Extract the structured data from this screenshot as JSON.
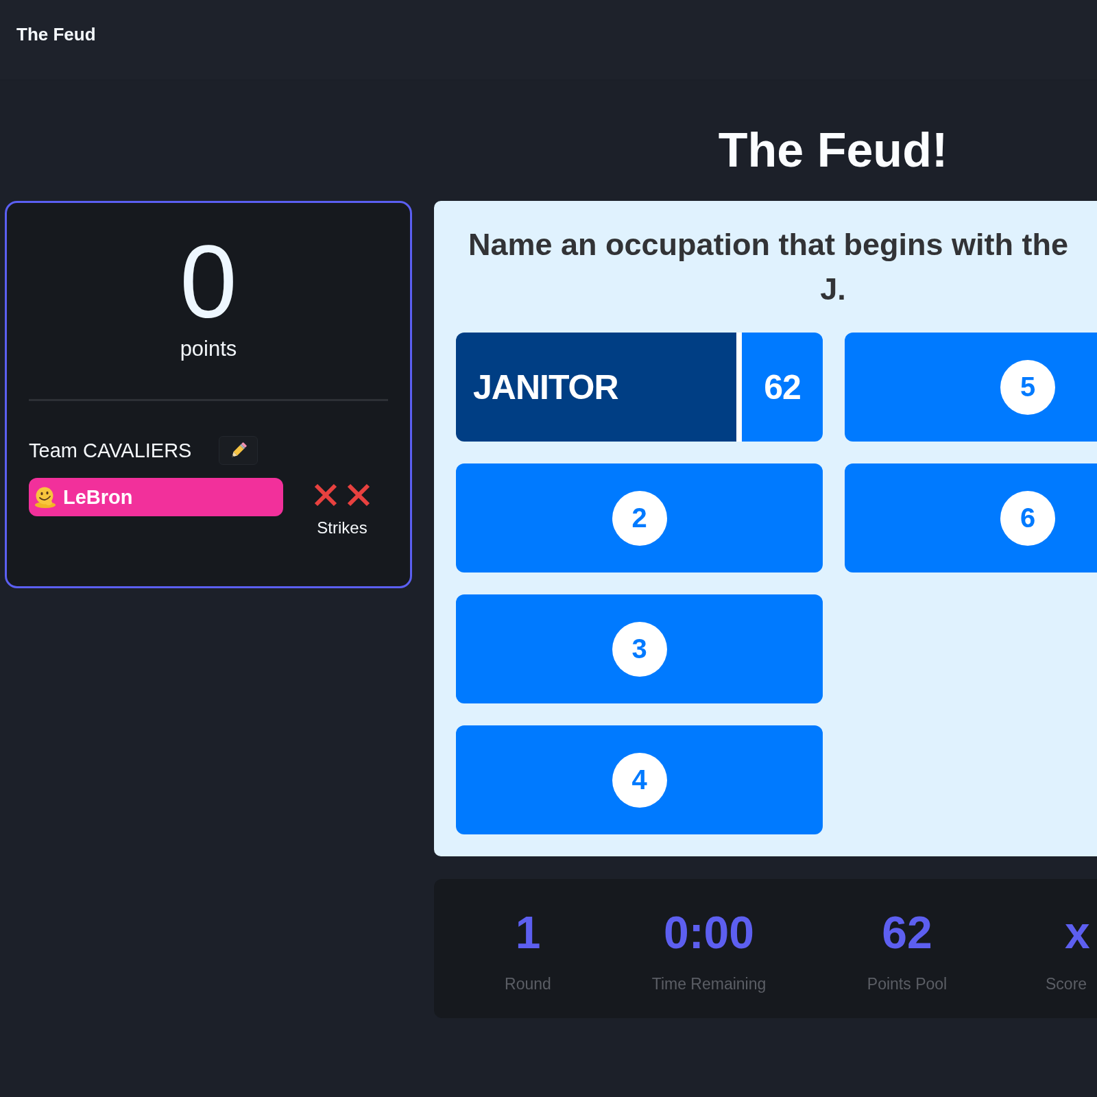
{
  "app_bar": {
    "title": "The Feud"
  },
  "heading": "The Feud!",
  "team_card": {
    "score": "0",
    "score_label": "points",
    "team_name": "Team CAVALIERS",
    "players": [
      {
        "name": "LeBron",
        "color": "#f2309b"
      }
    ],
    "strikes": {
      "label": "Strikes",
      "marks": [
        {
          "kind": "cross"
        },
        {
          "kind": "cross"
        }
      ]
    }
  },
  "board": {
    "question_lines": [
      "Name an occupation that begins with the",
      "J."
    ],
    "answers": [
      {
        "revealed": true,
        "text": "JANITOR",
        "points": "62"
      },
      {
        "revealed": false,
        "number": "2"
      },
      {
        "revealed": false,
        "number": "3"
      },
      {
        "revealed": false,
        "number": "4"
      },
      {
        "revealed": false,
        "number": "5"
      },
      {
        "revealed": false,
        "number": "6"
      }
    ]
  },
  "stats": [
    {
      "value": "1",
      "label": "Round"
    },
    {
      "value": "0:00",
      "label": "Time Remaining"
    },
    {
      "value": "62",
      "label": "Points Pool"
    },
    {
      "value": "x",
      "label": "Score"
    }
  ]
}
